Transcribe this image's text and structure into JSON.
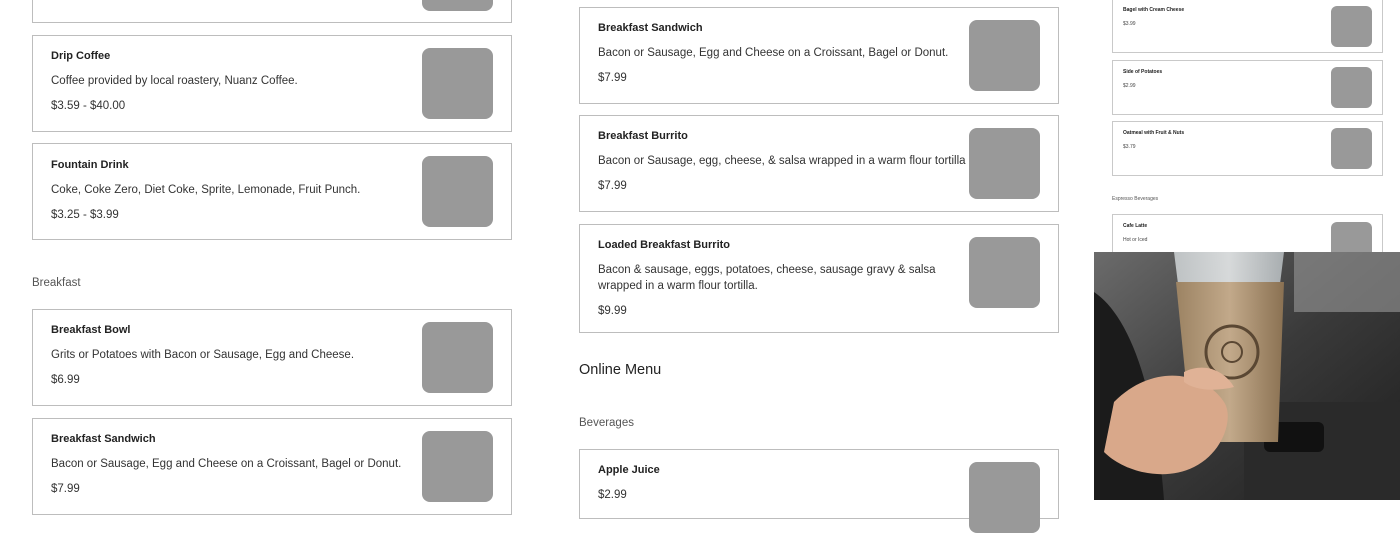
{
  "left": {
    "items_top": [
      {
        "title": "Drip Coffee",
        "desc": "Coffee provided by local roastery, Nuanz Coffee.",
        "price": "$3.59 - $40.00"
      },
      {
        "title": "Fountain Drink",
        "desc": "Coke, Coke Zero, Diet Coke, Sprite, Lemonade, Fruit Punch.",
        "price": "$3.25 - $3.99"
      }
    ],
    "section": "Breakfast",
    "items_bottom": [
      {
        "title": "Breakfast Bowl",
        "desc": "Grits or Potatoes with Bacon or Sausage, Egg and Cheese.",
        "price": "$6.99"
      },
      {
        "title": "Breakfast Sandwich",
        "desc": "Bacon or Sausage, Egg and Cheese on a Croissant, Bagel or Donut.",
        "price": "$7.99"
      }
    ]
  },
  "middle": {
    "items": [
      {
        "title": "Breakfast Sandwich",
        "desc": "Bacon or Sausage, Egg and Cheese on a Croissant, Bagel or Donut.",
        "price": "$7.99"
      },
      {
        "title": "Breakfast Burrito",
        "desc": "Bacon or Sausage, egg, cheese, & salsa wrapped in a warm flour tortilla",
        "price": "$7.99"
      },
      {
        "title": "Loaded Breakfast Burrito",
        "desc_line1": "Bacon & sausage, eggs, potatoes, cheese, sausage gravy & salsa",
        "desc_line2": "wrapped in a warm flour tortilla.",
        "price": "$9.99"
      }
    ],
    "online_menu": "Online Menu",
    "beverages": "Beverages",
    "apple_juice": {
      "title": "Apple Juice",
      "price": "$2.99"
    }
  },
  "mini": {
    "items": [
      {
        "title": "Bagel with Cream Cheese",
        "price": "$3.99"
      },
      {
        "title": "Side of Potatoes",
        "price": "$2.99"
      },
      {
        "title": "Oatmeal with Fruit & Nuts",
        "price": "$3.79"
      }
    ],
    "section": "Espresso Beverages",
    "latte": {
      "title": "Cafe Latte",
      "desc": "Hot or Iced"
    }
  }
}
